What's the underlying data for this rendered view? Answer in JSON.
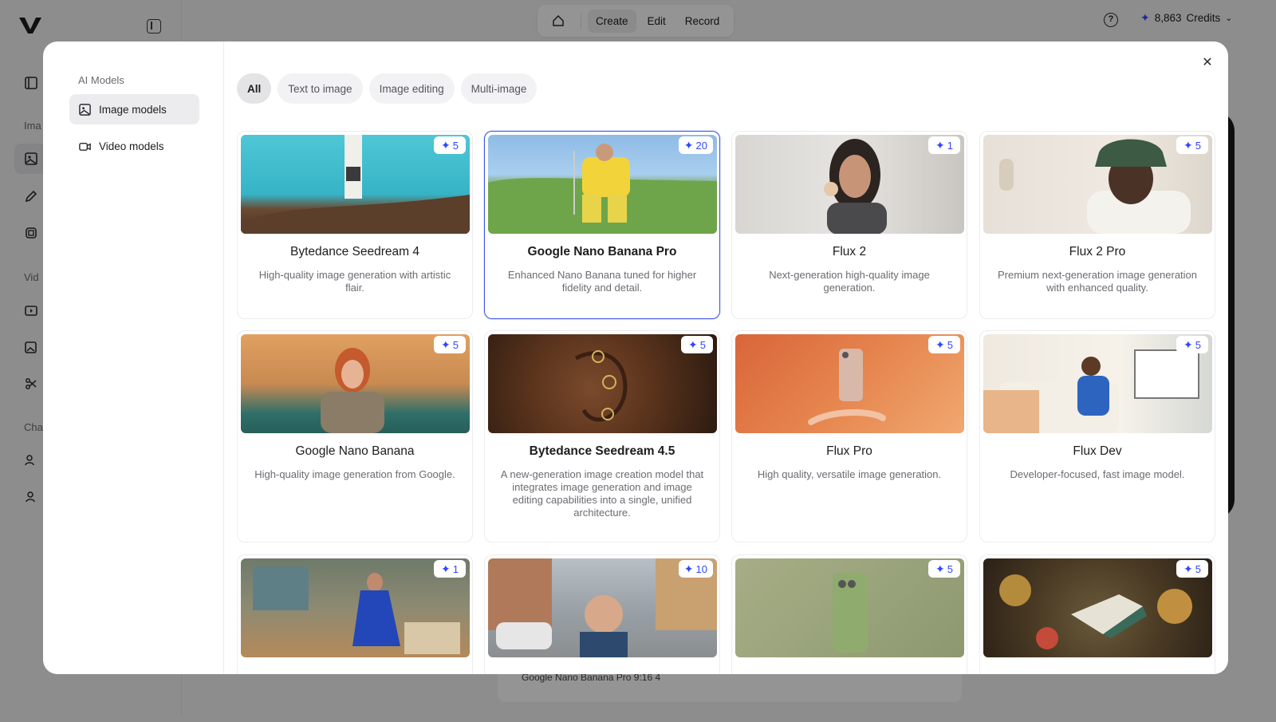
{
  "app": {
    "sidebar_labels": [
      "Ima",
      "Vid",
      "Cha"
    ],
    "nav": {
      "create": "Create",
      "edit": "Edit",
      "record": "Record"
    },
    "credits": {
      "amount": "8,863",
      "label": "Credits"
    },
    "bottom_bar_text": "Google Nano Banana Pro    9:16    4"
  },
  "modal": {
    "section_title": "AI Models",
    "side_items": [
      {
        "label": "Image models",
        "icon": "image-icon",
        "active": true
      },
      {
        "label": "Video models",
        "icon": "video-icon",
        "active": false
      }
    ],
    "filters": [
      "All",
      "Text to image",
      "Image editing",
      "Multi-image"
    ],
    "active_filter": "All",
    "accent_color": "#3d55e6",
    "badge_color": "#3147ff",
    "models": [
      {
        "title": "Bytedance Seedream 4",
        "desc": "High-quality image generation with artistic flair.",
        "cost": "5",
        "selected": false
      },
      {
        "title": "Google Nano Banana Pro",
        "desc": "Enhanced Nano Banana tuned for higher fidelity and detail.",
        "cost": "20",
        "selected": true
      },
      {
        "title": "Flux 2",
        "desc": "Next-generation high-quality image generation.",
        "cost": "1",
        "selected": false
      },
      {
        "title": "Flux 2 Pro",
        "desc": "Premium next-generation image generation with enhanced quality.",
        "cost": "5",
        "selected": false
      },
      {
        "title": "Google Nano Banana",
        "desc": "High-quality image generation from Google.",
        "cost": "5",
        "selected": false
      },
      {
        "title": "Bytedance Seedream 4.5",
        "desc": "A new-generation image creation model that integrates image generation and image editing capabilities into a single, unified architecture.",
        "cost": "5",
        "selected": false
      },
      {
        "title": "Flux Pro",
        "desc": "High quality, versatile image generation.",
        "cost": "5",
        "selected": false
      },
      {
        "title": "Flux Dev",
        "desc": "Developer-focused, fast image model.",
        "cost": "5",
        "selected": false
      },
      {
        "title": "",
        "desc": "",
        "cost": "1",
        "selected": false
      },
      {
        "title": "",
        "desc": "",
        "cost": "10",
        "selected": false
      },
      {
        "title": "",
        "desc": "",
        "cost": "5",
        "selected": false
      },
      {
        "title": "",
        "desc": "",
        "cost": "5",
        "selected": false
      }
    ]
  }
}
